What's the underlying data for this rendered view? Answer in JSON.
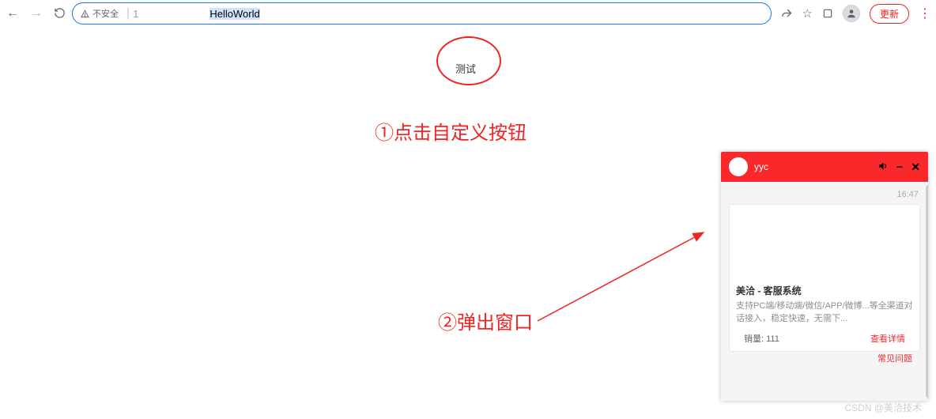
{
  "browser": {
    "addr_warn_label": "不安全",
    "addr_prefix": "1",
    "addr_selected": "HelloWorld",
    "update_label": "更新"
  },
  "page": {
    "test_button_label": "测试",
    "anno1": "①点击自定义按钮",
    "anno2": "②弹出窗口"
  },
  "chat": {
    "agent_name": "yyc",
    "time": "16:47",
    "card_title": "美洽 - 客服系统",
    "card_desc": "支持PC端/移动端/微信/APP/微博...等全渠道对话接入，稳定快速，无需下...",
    "sales_label": "销量: 111",
    "detail_link": "查看详情",
    "faq_link": "常见问题"
  },
  "watermark": "CSDN @美洽技术"
}
